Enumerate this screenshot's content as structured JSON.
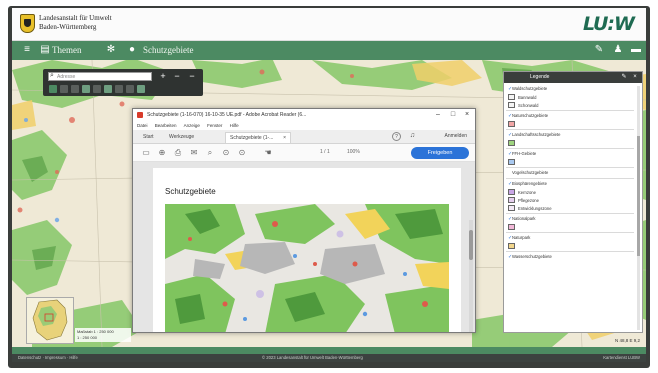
{
  "header": {
    "agency_line1": "Landesanstalt für Umwelt",
    "agency_line2": "Baden-Württemberg",
    "logo_text": "LU:W"
  },
  "toolbar": {
    "themes_label": "Themen",
    "layer_label": "Schutzgebiete"
  },
  "search": {
    "placeholder": "Adresse"
  },
  "pdf": {
    "window_title": "Schutzgebiete (1-16-070) 16-10-35 UE.pdf - Adobe Acrobat Reader (6...",
    "menu": [
      "Datei",
      "Bearbeiten",
      "Anzeige",
      "Fenster",
      "Hilfe"
    ],
    "tabs": {
      "start": "Start",
      "tools": "Werkzeuge",
      "document": "Schutzgebiete (1-..."
    },
    "share_label": "Anmelden",
    "page_info": "1 / 1",
    "zoom_info": "100%",
    "sign_button": "Freigeben",
    "heading": "Schutzgebiete"
  },
  "legend": {
    "title": "Legende",
    "items": [
      {
        "kind": "header",
        "label": "Waldschutzgebiete",
        "checked": true
      },
      {
        "kind": "entry",
        "label": "Bannwald",
        "swatch": "#f4f4f4"
      },
      {
        "kind": "entry",
        "label": "Schonwald",
        "swatch": "#f4f4f4"
      },
      {
        "kind": "header",
        "label": "Naturschutzgebiete",
        "checked": true
      },
      {
        "kind": "entry",
        "label": "",
        "swatch": "#f2a6a6"
      },
      {
        "kind": "header",
        "label": "Landschaftsschutzgebiete",
        "checked": true
      },
      {
        "kind": "entry",
        "label": "",
        "swatch": "#9ed47f"
      },
      {
        "kind": "header",
        "label": "FFH-Gebiete",
        "checked": true
      },
      {
        "kind": "entry",
        "label": "",
        "swatch": "#a9c9f0"
      },
      {
        "kind": "header",
        "label": "Vogelschutzgebiete",
        "checked": false
      },
      {
        "kind": "header",
        "label": "Biosphärengebiete",
        "checked": true
      },
      {
        "kind": "entry",
        "label": "Kernzone",
        "swatch": "#c9a6e6"
      },
      {
        "kind": "entry",
        "label": "Pflegezone",
        "swatch": "#e6cfee"
      },
      {
        "kind": "entry",
        "label": "Entwicklungszone",
        "swatch": "#f4eaf6"
      },
      {
        "kind": "header",
        "label": "Nationalpark",
        "checked": true
      },
      {
        "kind": "entry",
        "label": "",
        "swatch": "#f2b8d8"
      },
      {
        "kind": "header",
        "label": "Naturpark",
        "checked": true
      },
      {
        "kind": "entry",
        "label": "",
        "swatch": "#f2d68c"
      },
      {
        "kind": "header",
        "label": "Wasserschutzgebiete",
        "checked": true
      }
    ]
  },
  "map": {
    "scale_line1": "Maßstab 1 : 250 000",
    "scale_line2": "1 : 250 000",
    "coords": "N 48,8 E 9,2"
  },
  "status": {
    "left": "Datenschutz · Impressum · Hilfe",
    "center": "© 2023 Landesanstalt für Umwelt Baden-Württemberg",
    "right": "Kartendienst LUBW"
  },
  "colors": {
    "brand_green": "#4c8a62",
    "dark_bar": "#2f3331",
    "accent_blue": "#2b73d8"
  }
}
